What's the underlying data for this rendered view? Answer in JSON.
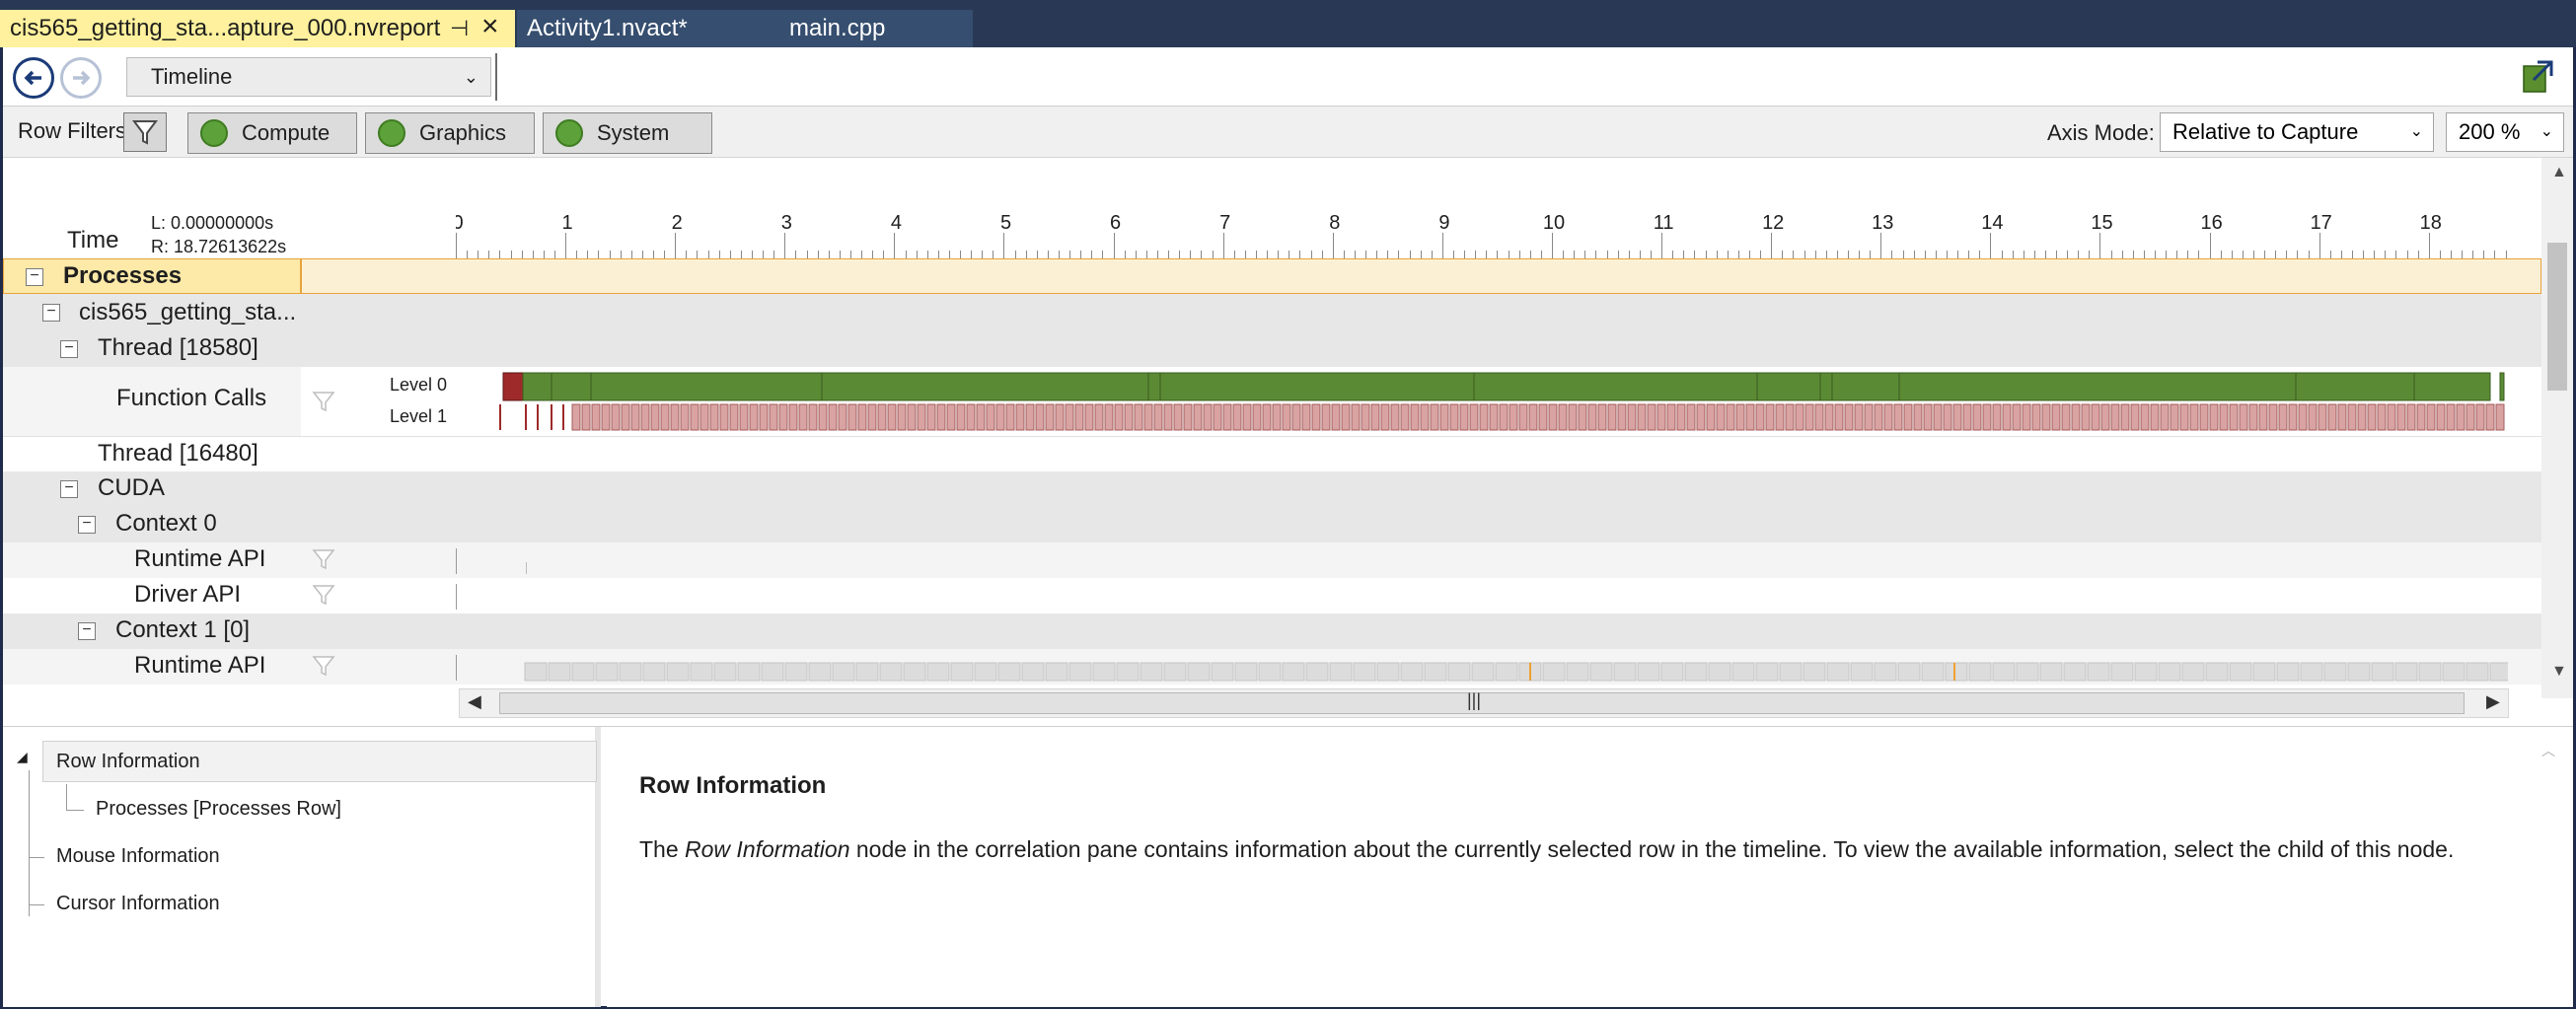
{
  "tabs": [
    {
      "label": "cis565_getting_sta...apture_000.nvreport",
      "active": true
    },
    {
      "label": "Activity1.nvact*"
    },
    {
      "label": "main.cpp"
    }
  ],
  "toolbar": {
    "view": "Timeline"
  },
  "filters": {
    "label": "Row Filters",
    "buttons": [
      "Compute",
      "Graphics",
      "System"
    ],
    "axis_mode_label": "Axis Mode:",
    "axis_mode_value": "Relative to Capture",
    "zoom": "200 %"
  },
  "timeline": {
    "time_label": "Time",
    "left": "L:  0.00000000s",
    "right": "R:  18.72613622s",
    "ticks": [
      "0",
      "1",
      "2",
      "3",
      "4",
      "5",
      "6",
      "7",
      "8",
      "9",
      "10",
      "11",
      "12",
      "13",
      "14",
      "15",
      "16",
      "17",
      "18"
    ]
  },
  "rows": {
    "processes": "Processes",
    "process": "cis565_getting_sta...",
    "thread1": "Thread [18580]",
    "function_calls": "Function Calls",
    "level0": "Level 0",
    "level1": "Level 1",
    "thread2": "Thread [16480]",
    "cuda": "CUDA",
    "context0": "Context 0",
    "runtime_api": "Runtime API",
    "driver_api": "Driver API",
    "context1": "Context 1 [0]",
    "runtime_api2": "Runtime API"
  },
  "tree": {
    "row_info": "Row Information",
    "processes_row": "Processes [Processes Row]",
    "mouse_info": "Mouse Information",
    "cursor_info": "Cursor Information"
  },
  "detail": {
    "title": "Row Information",
    "text_pre": "The ",
    "text_em": "Row Information",
    "text_post": " node in the correlation pane contains information about the currently selected row in the timeline. To view the available information, select the child of this node."
  },
  "colors": {
    "green": "#5b8a34",
    "red": "#9e2a2a",
    "pink": "#d9a3a3",
    "highlight": "#fde9a8"
  }
}
